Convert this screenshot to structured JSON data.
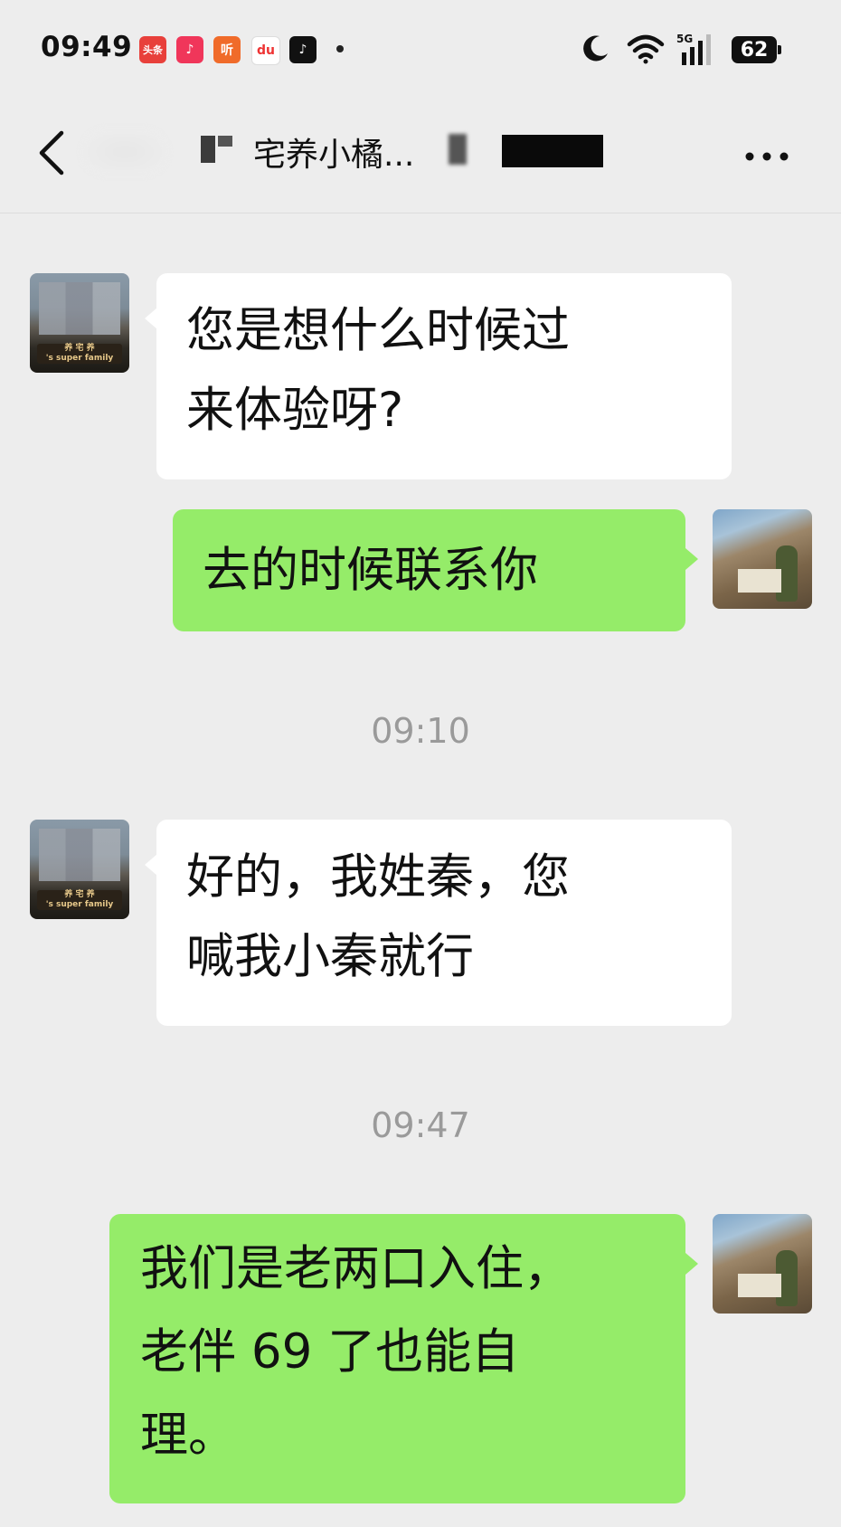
{
  "status_bar": {
    "time": "09:49",
    "apps": [
      {
        "name": "toutiao",
        "label": "头条"
      },
      {
        "name": "music",
        "label": "♪"
      },
      {
        "name": "ting",
        "label": "听"
      },
      {
        "name": "du",
        "label": "du"
      },
      {
        "name": "tiktok",
        "label": "♪"
      }
    ],
    "network": "5G",
    "battery": "62"
  },
  "header": {
    "title": "宅养小橘..."
  },
  "messages": [
    {
      "sender": "contact",
      "text": "您是想什么时候过来体验呀?"
    },
    {
      "sender": "self",
      "text": "去的时候联系你"
    },
    {
      "timestamp": "09:10"
    },
    {
      "sender": "contact",
      "text": "好的，我姓秦，您喊我小秦就行"
    },
    {
      "timestamp": "09:47"
    },
    {
      "sender": "self",
      "text": "我们是老两口入住，老伴 69 了也能自理。"
    }
  ],
  "display": {
    "msg1_lines": [
      "您是想什么时候过",
      "来体验呀?"
    ],
    "msg3_lines": [
      "好的，我姓秦，您",
      "喊我小秦就行"
    ],
    "msg4_lines": [
      "我们是老两口入住，",
      "老伴 69 了也能自",
      "理。"
    ]
  },
  "avatars": {
    "contact_sign_text": "养 宅 养",
    "contact_sign_sub": "'s super family"
  },
  "colors": {
    "background": "#ededed",
    "incoming_bubble": "#ffffff",
    "outgoing_bubble": "#95ec69",
    "timestamp_text": "#9a9a9a"
  }
}
